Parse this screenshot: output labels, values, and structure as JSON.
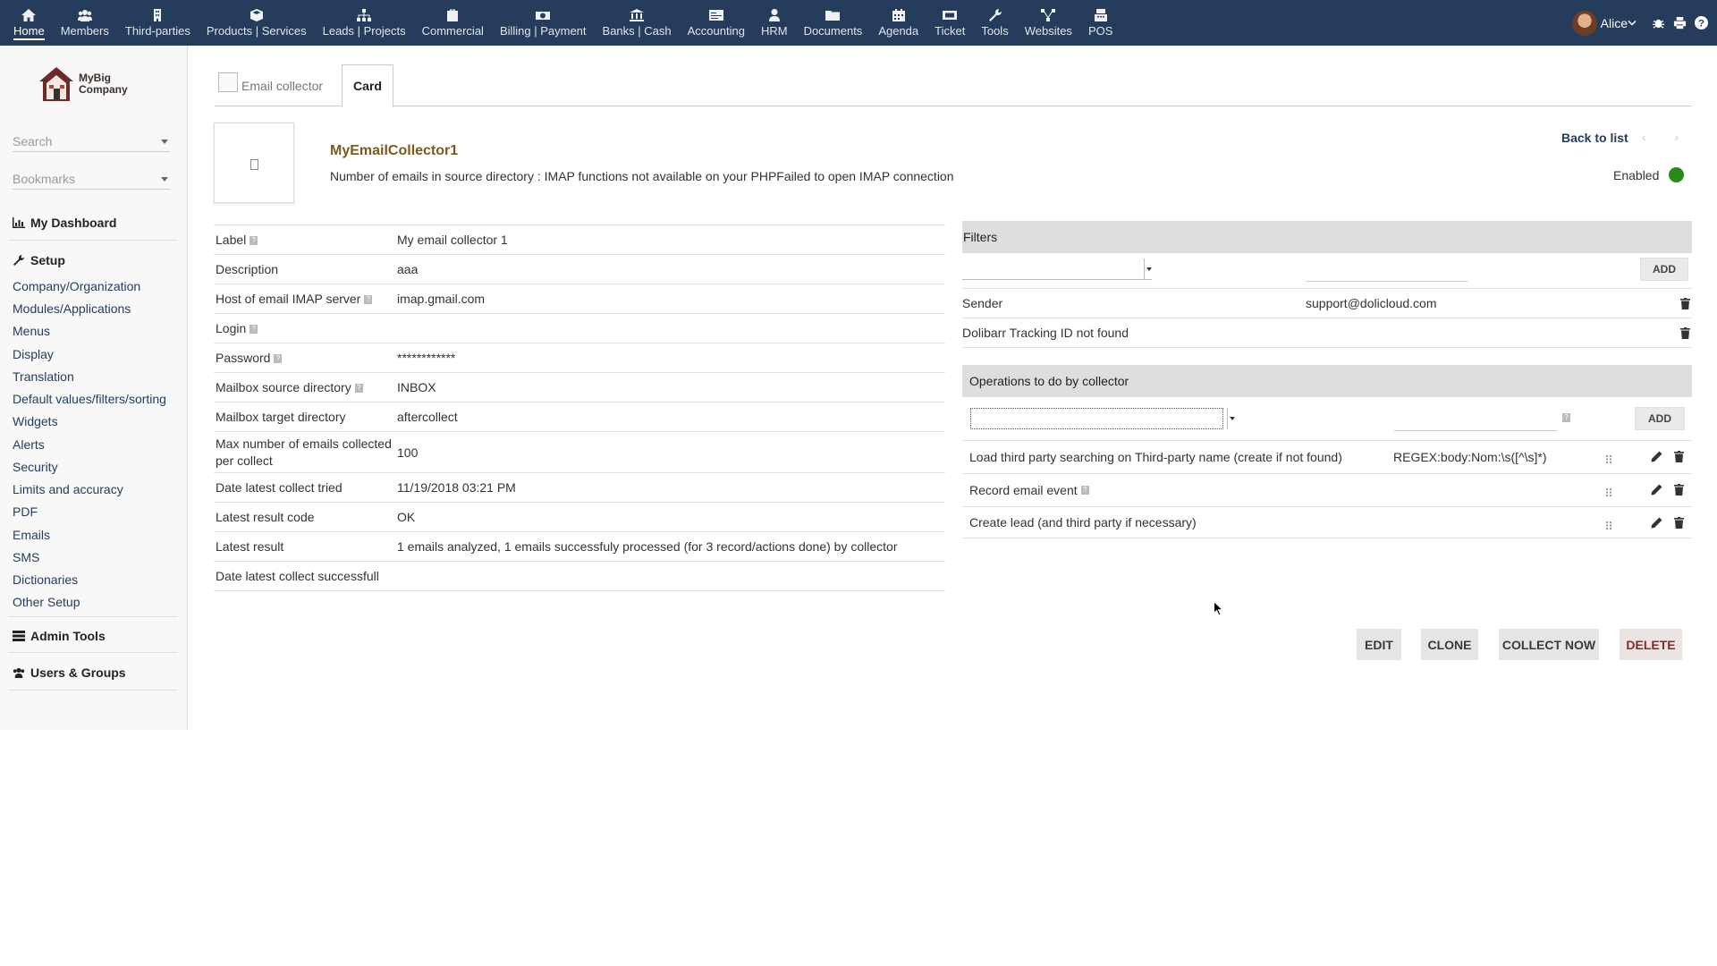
{
  "topnav": {
    "items": [
      {
        "label": "Home",
        "icon": "home-icon"
      },
      {
        "label": "Members",
        "icon": "members-icon"
      },
      {
        "label": "Third-parties",
        "icon": "building-icon"
      },
      {
        "label": "Products | Services",
        "icon": "cube-icon"
      },
      {
        "label": "Leads | Projects",
        "icon": "sitemap-icon"
      },
      {
        "label": "Commercial",
        "icon": "suitcase-icon"
      },
      {
        "label": "Billing | Payment",
        "icon": "money-icon"
      },
      {
        "label": "Banks | Cash",
        "icon": "bank-icon"
      },
      {
        "label": "Accounting",
        "icon": "ledger-icon"
      },
      {
        "label": "HRM",
        "icon": "user-tie-icon"
      },
      {
        "label": "Documents",
        "icon": "folder-icon"
      },
      {
        "label": "Agenda",
        "icon": "calendar-icon"
      },
      {
        "label": "Ticket",
        "icon": "ticket-icon"
      },
      {
        "label": "Tools",
        "icon": "wrench-icon"
      },
      {
        "label": "Websites",
        "icon": "network-icon"
      },
      {
        "label": "POS",
        "icon": "cash-register-icon"
      }
    ],
    "user_name": "Alice"
  },
  "sidebar": {
    "logo_text_1": "MyBig",
    "logo_text_2": "Company",
    "search_placeholder": "Search",
    "bookmarks_placeholder": "Bookmarks",
    "dashboard": "My Dashboard",
    "setup": "Setup",
    "setup_items": [
      "Company/Organization",
      "Modules/Applications",
      "Menus",
      "Display",
      "Translation",
      "Default values/filters/sorting",
      "Widgets",
      "Alerts",
      "Security",
      "Limits and accuracy",
      "PDF",
      "Emails",
      "SMS",
      "Dictionaries",
      "Other Setup"
    ],
    "admin_tools": "Admin Tools",
    "users_groups": "Users & Groups"
  },
  "tabs": {
    "tab1": "Email collector",
    "tab2": "Card"
  },
  "header": {
    "ref": "MyEmailCollector1",
    "subtitle": "Number of emails in source directory : IMAP functions not available on your PHPFailed to open IMAP connection",
    "back_to_list": "Back to list",
    "prev_next": "‹ ›",
    "status": "Enabled",
    "status_color": "#2a8a19"
  },
  "fields": [
    {
      "label": "Label",
      "value": "My email collector 1",
      "help": true
    },
    {
      "label": "Description",
      "value": "aaa",
      "help": false
    },
    {
      "label": "Host of email IMAP server",
      "value": "imap.gmail.com",
      "help": true
    },
    {
      "label": "Login",
      "value": "",
      "help": true
    },
    {
      "label": "Password",
      "value": "************",
      "help": true
    },
    {
      "label": "Mailbox source directory",
      "value": "INBOX",
      "help": true
    },
    {
      "label": "Mailbox target directory",
      "value": "aftercollect",
      "help": false
    },
    {
      "label": "Max number of emails collected per collect",
      "value": "100",
      "help": false
    },
    {
      "label": "Date latest collect tried",
      "value": "11/19/2018 03:21 PM",
      "help": false
    },
    {
      "label": "Latest result code",
      "value": "OK",
      "help": false
    },
    {
      "label": "Latest result",
      "value": "1 emails analyzed, 1 emails successfuly processed (for 3 record/actions done) by collector",
      "help": false
    },
    {
      "label": "Date latest collect successfull",
      "value": "",
      "help": false
    }
  ],
  "filters": {
    "title": "Filters",
    "add_label": "ADD",
    "rows": [
      {
        "name": "Sender",
        "value": "support@dolicloud.com"
      },
      {
        "name": "Dolibarr Tracking ID not found",
        "value": ""
      }
    ]
  },
  "operations": {
    "title": "Operations to do by collector",
    "add_label": "ADD",
    "rows": [
      {
        "name": "Load third party searching on Third-party name (create if not found)",
        "value": "REGEX:body:Nom:\\s([^\\s]*)"
      },
      {
        "name": "Record email event",
        "value": ""
      },
      {
        "name": "Create lead (and third party if necessary)",
        "value": ""
      }
    ]
  },
  "actions": {
    "edit": "EDIT",
    "clone": "CLONE",
    "collect_now": "COLLECT NOW",
    "delete": "DELETE"
  }
}
